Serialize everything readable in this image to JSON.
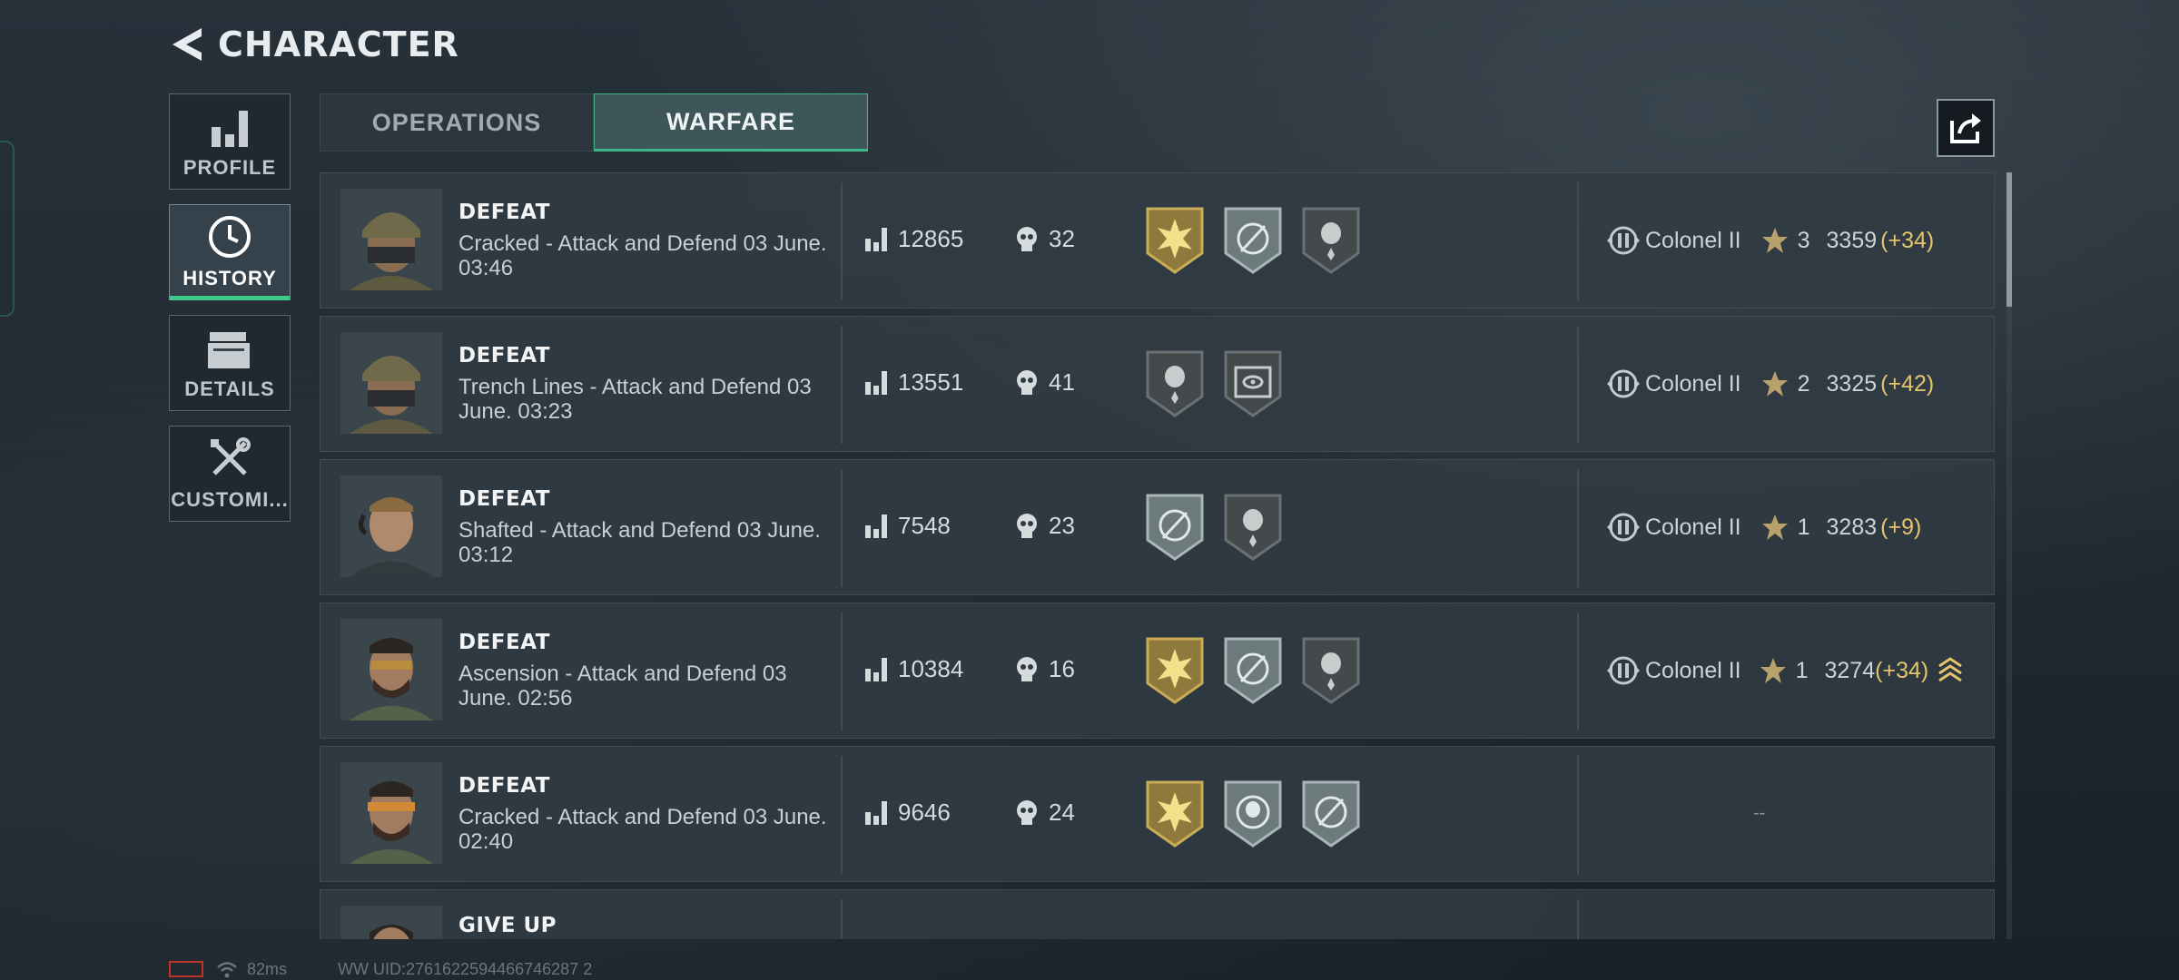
{
  "header": {
    "title": "CHARACTER",
    "back_icon": "back-arrow-icon"
  },
  "sidebar": {
    "items": [
      {
        "label": "PROFILE",
        "icon": "bar-chart-icon",
        "active": false
      },
      {
        "label": "HISTORY",
        "icon": "clock-icon",
        "active": true
      },
      {
        "label": "DETAILS",
        "icon": "folders-icon",
        "active": false
      },
      {
        "label": "CUSTOMI...",
        "icon": "tools-icon",
        "active": false
      }
    ]
  },
  "tabs": [
    {
      "label": "OPERATIONS",
      "active": false
    },
    {
      "label": "WARFARE",
      "active": true
    }
  ],
  "share_icon": "share-icon",
  "colors": {
    "accent": "#3fc98c",
    "gold": "#e4c56d",
    "row_bg": "#313b43"
  },
  "matches": [
    {
      "result": "DEFEAT",
      "map": "Cracked - Attack and Defend 03 June. 03:46",
      "score": "12865",
      "kills": "32",
      "medals": [
        "gold-burst-medal",
        "silver-target-medal",
        "dark-skull-medal"
      ],
      "rank": "Colonel II",
      "stars": "3",
      "points": "3359",
      "delta": "(+34)",
      "avatar": "soldier-helmet"
    },
    {
      "result": "DEFEAT",
      "map": "Trench Lines - Attack and Defend 03 June. 03:23",
      "score": "13551",
      "kills": "41",
      "medals": [
        "dark-skull-medal",
        "dark-eye-medal"
      ],
      "rank": "Colonel II",
      "stars": "2",
      "points": "3325",
      "delta": "(+42)",
      "avatar": "soldier-helmet"
    },
    {
      "result": "DEFEAT",
      "map": "Shafted - Attack and Defend 03 June. 03:12",
      "score": "7548",
      "kills": "23",
      "medals": [
        "silver-target-medal",
        "dark-skull-medal"
      ],
      "rank": "Colonel II",
      "stars": "1",
      "points": "3283",
      "delta": "(+9)",
      "avatar": "soldier-headset"
    },
    {
      "result": "DEFEAT",
      "map": "Ascension - Attack and Defend 03 June. 02:56",
      "score": "10384",
      "kills": "16",
      "medals": [
        "gold-burst-medal",
        "silver-target-medal",
        "dark-skull-medal"
      ],
      "rank": "Colonel II",
      "stars": "1",
      "points": "3274",
      "delta": "(+34)",
      "promotion_icon": "rank-up-chevrons-icon",
      "avatar": "soldier-glasses"
    },
    {
      "result": "DEFEAT",
      "map": "Cracked - Attack and Defend 03 June. 02:40",
      "score": "9646",
      "kills": "24",
      "medals": [
        "gold-burst-medal",
        "silver-skull-medal",
        "silver-target-medal"
      ],
      "rank": "",
      "stars": "",
      "points": "",
      "delta": "",
      "empty": "--",
      "avatar": "soldier-glasses"
    },
    {
      "result": "GIVE UP",
      "map": "",
      "score": "",
      "kills": "",
      "medals": [],
      "rank": "",
      "avatar": "soldier-glasses"
    }
  ],
  "status": {
    "ping": "82ms",
    "uid": "WW UID:2761622594466746287 2"
  }
}
